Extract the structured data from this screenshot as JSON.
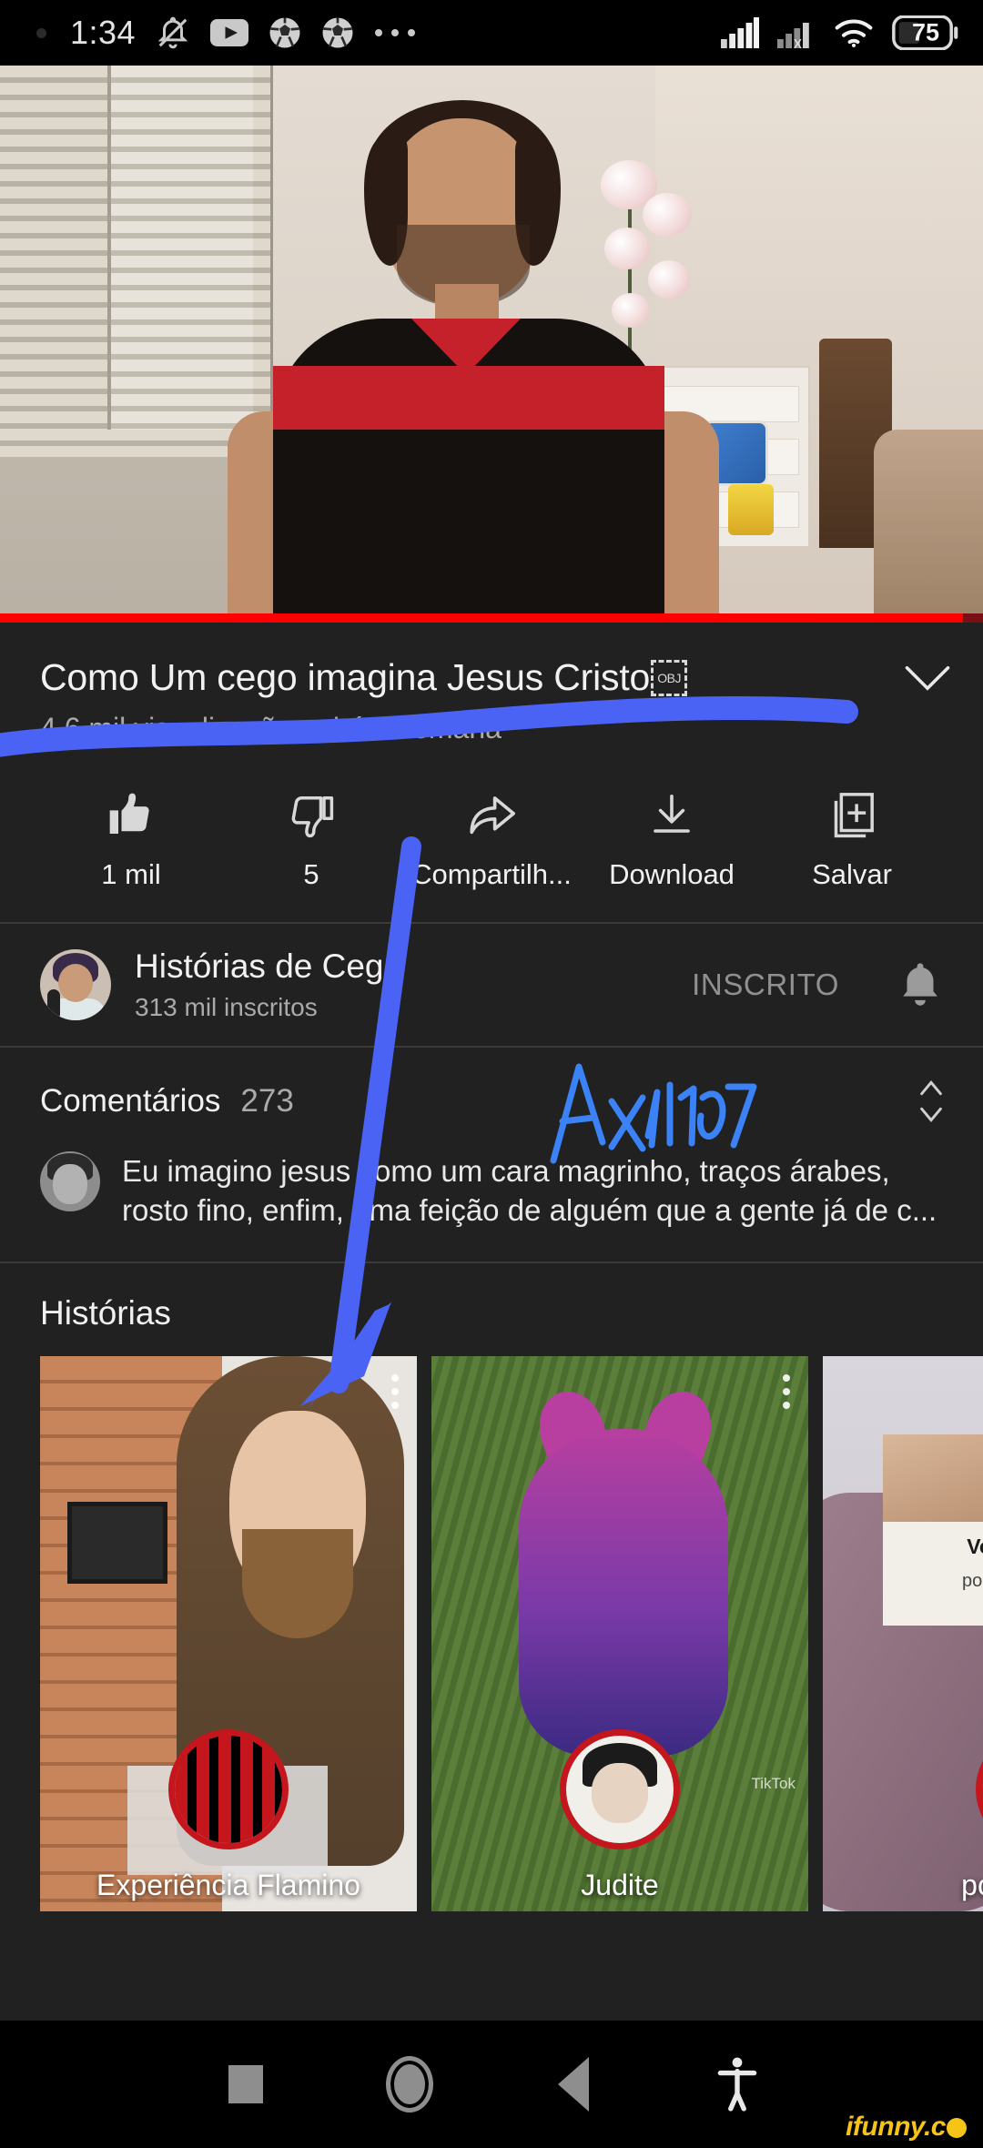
{
  "status_bar": {
    "time": "1:34",
    "left_icons": [
      "bell-off-icon",
      "youtube-icon",
      "soccer-ball-icon",
      "soccer-ball-icon",
      "more-dots-icon"
    ],
    "right_icons": [
      "signal-full-icon",
      "signal-no-sim-icon",
      "wifi-icon"
    ],
    "battery_level": "75"
  },
  "video": {
    "title": "Como Um cego imagina Jesus Cristo",
    "title_obj_glyph": "OBJ",
    "meta": "4,6 mil visualizações · há 1 semana",
    "expand_icon": "chevron-down-icon",
    "progress_percent": 98
  },
  "actions": [
    {
      "id": "like",
      "label": "1 mil",
      "icon": "thumbs-up-icon"
    },
    {
      "id": "dislike",
      "label": "5",
      "icon": "thumbs-down-icon"
    },
    {
      "id": "share",
      "label": "Compartilh...",
      "icon": "share-arrow-icon"
    },
    {
      "id": "download",
      "label": "Download",
      "icon": "download-icon"
    },
    {
      "id": "save",
      "label": "Salvar",
      "icon": "save-playlist-icon"
    }
  ],
  "channel": {
    "name": "Histórias de Cego",
    "subscribers": "313 mil inscritos",
    "subscribe_state": "INSCRITO",
    "bell_icon": "notification-bell-icon",
    "avatar": "channel-avatar"
  },
  "comments": {
    "heading": "Comentários",
    "count": "273",
    "sort_icon": "sort-updown-icon",
    "top_comment": "Eu imagino jesus como um cara magrinho, traços árabes, rosto fino, enfim, uma feição de alguém que a gente já de c..."
  },
  "shorts": {
    "heading": "Histórias",
    "items": [
      {
        "label": "Experiência Flamino",
        "kebab_icon": "more-vertical-icon"
      },
      {
        "label": "Judite",
        "kebab_icon": "more-vertical-icon"
      },
      {
        "label": "pobre",
        "kebab_icon": "more-vertical-icon",
        "overlay_line1": "Você n",
        "overlay_line2": "pobre na"
      }
    ]
  },
  "nav_bar": {
    "recents": "recents-square-icon",
    "home": "home-circle-icon",
    "back": "back-triangle-icon",
    "accessibility": "accessibility-icon"
  },
  "watermark": {
    "text": "ifunny.c"
  },
  "annotations": {
    "handwriting": "Ax1l701",
    "marker_color": "#4a63f5"
  }
}
